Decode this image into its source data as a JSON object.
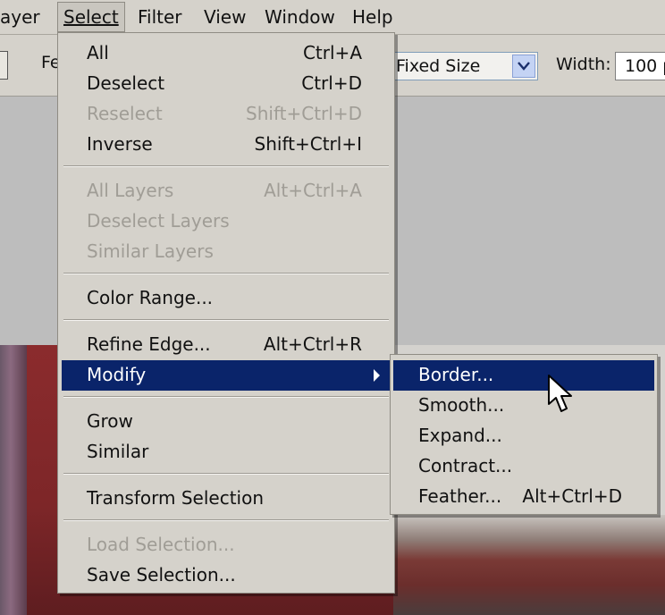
{
  "menubar": {
    "items": [
      {
        "label": "ayer"
      },
      {
        "label": "Select"
      },
      {
        "label": "Filter"
      },
      {
        "label": "View"
      },
      {
        "label": "Window"
      },
      {
        "label": "Help"
      }
    ]
  },
  "options": {
    "feather_label_partial": "Fe",
    "style_value": "Fixed Size",
    "width_label": "Width:",
    "width_value": "100 p"
  },
  "select_menu": {
    "items": [
      {
        "label": "All",
        "shortcut": "Ctrl+A",
        "enabled": true
      },
      {
        "label": "Deselect",
        "shortcut": "Ctrl+D",
        "enabled": true
      },
      {
        "label": "Reselect",
        "shortcut": "Shift+Ctrl+D",
        "enabled": false
      },
      {
        "label": "Inverse",
        "shortcut": "Shift+Ctrl+I",
        "enabled": true
      },
      {
        "label": "All Layers",
        "shortcut": "Alt+Ctrl+A",
        "enabled": false
      },
      {
        "label": "Deselect Layers",
        "shortcut": "",
        "enabled": false
      },
      {
        "label": "Similar Layers",
        "shortcut": "",
        "enabled": false
      },
      {
        "label": "Color Range...",
        "shortcut": "",
        "enabled": true
      },
      {
        "label": "Refine Edge...",
        "shortcut": "Alt+Ctrl+R",
        "enabled": true
      },
      {
        "label": "Modify",
        "shortcut": "",
        "enabled": true,
        "highlighted": true
      },
      {
        "label": "Grow",
        "shortcut": "",
        "enabled": true
      },
      {
        "label": "Similar",
        "shortcut": "",
        "enabled": true
      },
      {
        "label": "Transform Selection",
        "shortcut": "",
        "enabled": true
      },
      {
        "label": "Load Selection...",
        "shortcut": "",
        "enabled": false
      },
      {
        "label": "Save Selection...",
        "shortcut": "",
        "enabled": true
      }
    ]
  },
  "modify_submenu": {
    "items": [
      {
        "label": "Border...",
        "shortcut": "",
        "highlighted": true
      },
      {
        "label": "Smooth...",
        "shortcut": ""
      },
      {
        "label": "Expand...",
        "shortcut": ""
      },
      {
        "label": "Contract...",
        "shortcut": ""
      },
      {
        "label": "Feather...",
        "shortcut": "Alt+Ctrl+D"
      }
    ]
  },
  "colors": {
    "menu_bg": "#d5d2cb",
    "highlight": "#0a246a",
    "disabled_text": "#a09d96"
  }
}
